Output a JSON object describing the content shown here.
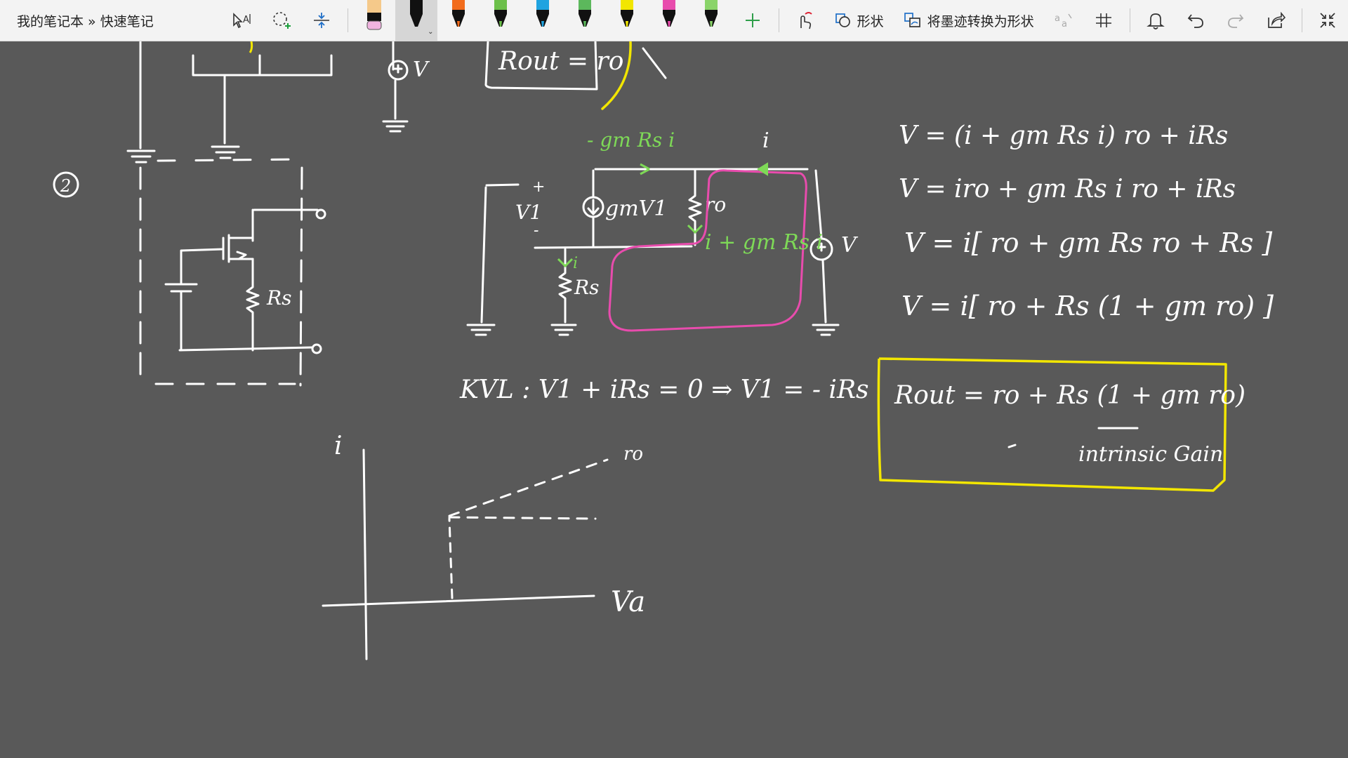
{
  "window": {
    "breadcrumb": "我的笔记本 » 快速笔记"
  },
  "toolbar": {
    "shapes_label": "形状",
    "ink_to_shape_label": "将墨迹转换为形状",
    "pens": [
      {
        "icon": "highlighter-pink",
        "color": "#f0b4e0",
        "selected": false
      },
      {
        "icon": "pen-black",
        "color": "#111111",
        "selected": true
      },
      {
        "icon": "pen-orange",
        "color": "#f26c1c",
        "selected": false
      },
      {
        "icon": "pen-green",
        "color": "#6cc04a",
        "selected": false
      },
      {
        "icon": "pen-blue",
        "color": "#1fa3e0",
        "selected": false
      },
      {
        "icon": "pen-green2",
        "color": "#5cb85c",
        "selected": false
      },
      {
        "icon": "pen-yellow",
        "color": "#f2e600",
        "selected": false
      },
      {
        "icon": "pen-magenta",
        "color": "#e84cad",
        "selected": false
      },
      {
        "icon": "pen-lime",
        "color": "#8ad46a",
        "selected": false
      }
    ]
  },
  "note": {
    "top_box": "Rout = ro",
    "circle_number": "2",
    "rs_label_left": "Rs",
    "top_v_label": "V",
    "green_top": "- gm Rs i",
    "i_top": "i",
    "v1_label": "V1",
    "plus": "+",
    "minus": "-",
    "gm_source": "gmV1",
    "ro_label": "ro",
    "green_mid": "i + gm Rs i",
    "i_small": "i",
    "rs_label_mid": "Rs",
    "v_right": "V",
    "kvl": "KVL :   V1 + iRs = 0  ⇒  V1 = - iRs",
    "eq1": "V = (i + gm Rs i) ro  + iRs",
    "eq2": "V = iro + gm Rs i ro + iRs",
    "eq3": "V = i[ ro + gm Rs ro + Rs ]",
    "eq4": "V = i[ ro + Rs (1 + gm ro) ]",
    "rout_result": "Rout = ro + Rs (1 + gm ro)",
    "intrinsic_gain": "intrinsic Gain",
    "graph_y": "i",
    "graph_ro": "ro",
    "graph_x": "Va"
  },
  "colors": {
    "background": "#595959",
    "ink": "#ffffff",
    "green_ink": "#7ed957",
    "pink_ink": "#e84cad",
    "yellow_ink": "#f2e600"
  }
}
